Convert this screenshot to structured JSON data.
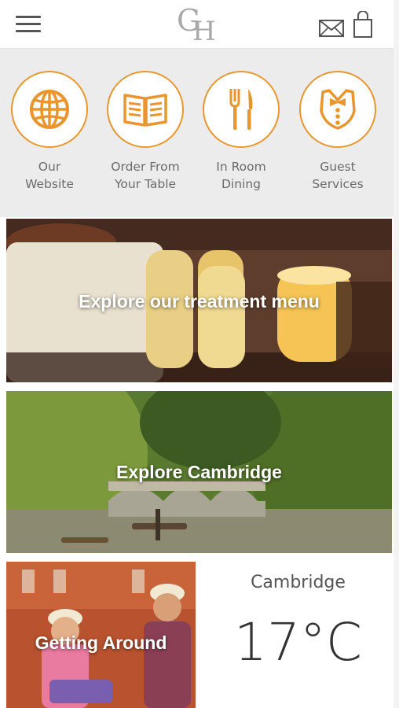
{
  "header": {
    "logo_letters": "GH"
  },
  "quick_links": [
    {
      "label_line1": "Our",
      "label_line2": "Website",
      "icon": "globe-icon"
    },
    {
      "label_line1": "Order From",
      "label_line2": "Your Table",
      "icon": "menu-book-icon"
    },
    {
      "label_line1": "In Room",
      "label_line2": "Dining",
      "icon": "cutlery-icon"
    },
    {
      "label_line1": "Guest",
      "label_line2": "Services",
      "icon": "butler-icon"
    }
  ],
  "banners": {
    "treatment": "Explore our treatment menu",
    "cambridge": "Explore Cambridge",
    "getting_around": "Getting Around"
  },
  "weather": {
    "city": "Cambridge",
    "temperature": "17°C"
  },
  "colors": {
    "accent": "#e8962d",
    "panel_bg": "#ececec"
  }
}
